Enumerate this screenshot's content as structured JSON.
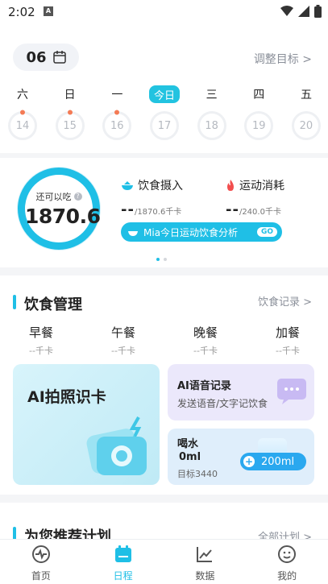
{
  "status": {
    "time": "2:02",
    "notif": "A"
  },
  "header": {
    "date": "06",
    "adjust_goal": "调整目标 >"
  },
  "week": [
    {
      "label": "六",
      "day": "14",
      "today": false,
      "dot": "#f47b55"
    },
    {
      "label": "日",
      "day": "15",
      "today": false,
      "dot": "#f47b55"
    },
    {
      "label": "一",
      "day": "16",
      "today": false,
      "dot": "#f47b55"
    },
    {
      "label": "今日",
      "day": "17",
      "today": true,
      "dot": ""
    },
    {
      "label": "三",
      "day": "18",
      "today": false,
      "dot": ""
    },
    {
      "label": "四",
      "day": "19",
      "today": false,
      "dot": ""
    },
    {
      "label": "五",
      "day": "20",
      "today": false,
      "dot": ""
    }
  ],
  "summary": {
    "remaining_label": "还可以吃",
    "remaining_value": "1870.6",
    "intake_title": "饮食摄入",
    "intake_value": "--",
    "intake_target": "/1870.6千卡",
    "burn_title": "运动消耗",
    "burn_value": "--",
    "burn_target": "/240.0千卡",
    "analysis_label": "Mia今日运动饮食分析",
    "analysis_badge": "GO"
  },
  "diet": {
    "title": "饮食管理",
    "link": "饮食记录 >",
    "meals": [
      {
        "name": "早餐",
        "value": "--千卡"
      },
      {
        "name": "午餐",
        "value": "--千卡"
      },
      {
        "name": "晚餐",
        "value": "--千卡"
      },
      {
        "name": "加餐",
        "value": "--千卡"
      }
    ],
    "ai_photo": "AI拍照识卡",
    "ai_voice_title": "AI语音记录",
    "ai_voice_sub": "发送语音/文字记饮食",
    "water_title": "喝水",
    "water_amount": "0ml",
    "water_goal": "目标3440",
    "water_button": "200ml"
  },
  "recommend": {
    "title": "为您推荐计划",
    "link": "全部计划 >"
  },
  "tabs": [
    {
      "label": "首页",
      "icon": "home-pulse-icon",
      "active": false
    },
    {
      "label": "日程",
      "icon": "calendar-icon",
      "active": true
    },
    {
      "label": "数据",
      "icon": "chart-icon",
      "active": false
    },
    {
      "label": "我的",
      "icon": "profile-icon",
      "active": false
    }
  ]
}
